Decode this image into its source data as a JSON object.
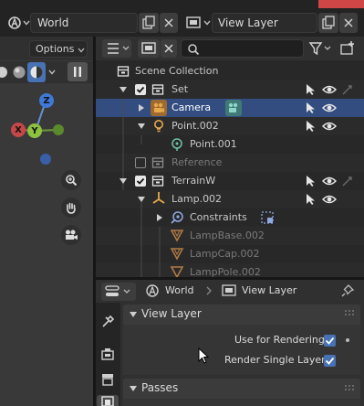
{
  "topbar": {
    "scene_name": "World",
    "view_layer_name": "View Layer"
  },
  "viewport": {
    "options_label": "Options",
    "gizmo": {
      "x_label": "X",
      "y_label": "Y",
      "z_label": "Z"
    }
  },
  "outliner": {
    "search_placeholder": "",
    "items": [
      {
        "label": "Scene Collection"
      },
      {
        "label": "Set"
      },
      {
        "label": "Camera"
      },
      {
        "label": "Point.002"
      },
      {
        "label": "Point.001"
      },
      {
        "label": "Reference"
      },
      {
        "label": "TerrainW"
      },
      {
        "label": "Lamp.002"
      },
      {
        "label": "Constraints"
      },
      {
        "label": "LampBase.002"
      },
      {
        "label": "LampCap.002"
      },
      {
        "label": "LampPole.002"
      }
    ]
  },
  "properties": {
    "breadcrumb_world": "World",
    "breadcrumb_view_layer": "View Layer",
    "panel_view_layer": "View Layer",
    "use_for_rendering_label": "Use for Rendering",
    "render_single_layer_label": "Render Single Layer",
    "panel_passes": "Passes"
  },
  "colors": {
    "selection": "#334d80",
    "accent": "#4772b3",
    "camera_orange": "#e8a94a",
    "collection_white": "#e6e6e6"
  }
}
